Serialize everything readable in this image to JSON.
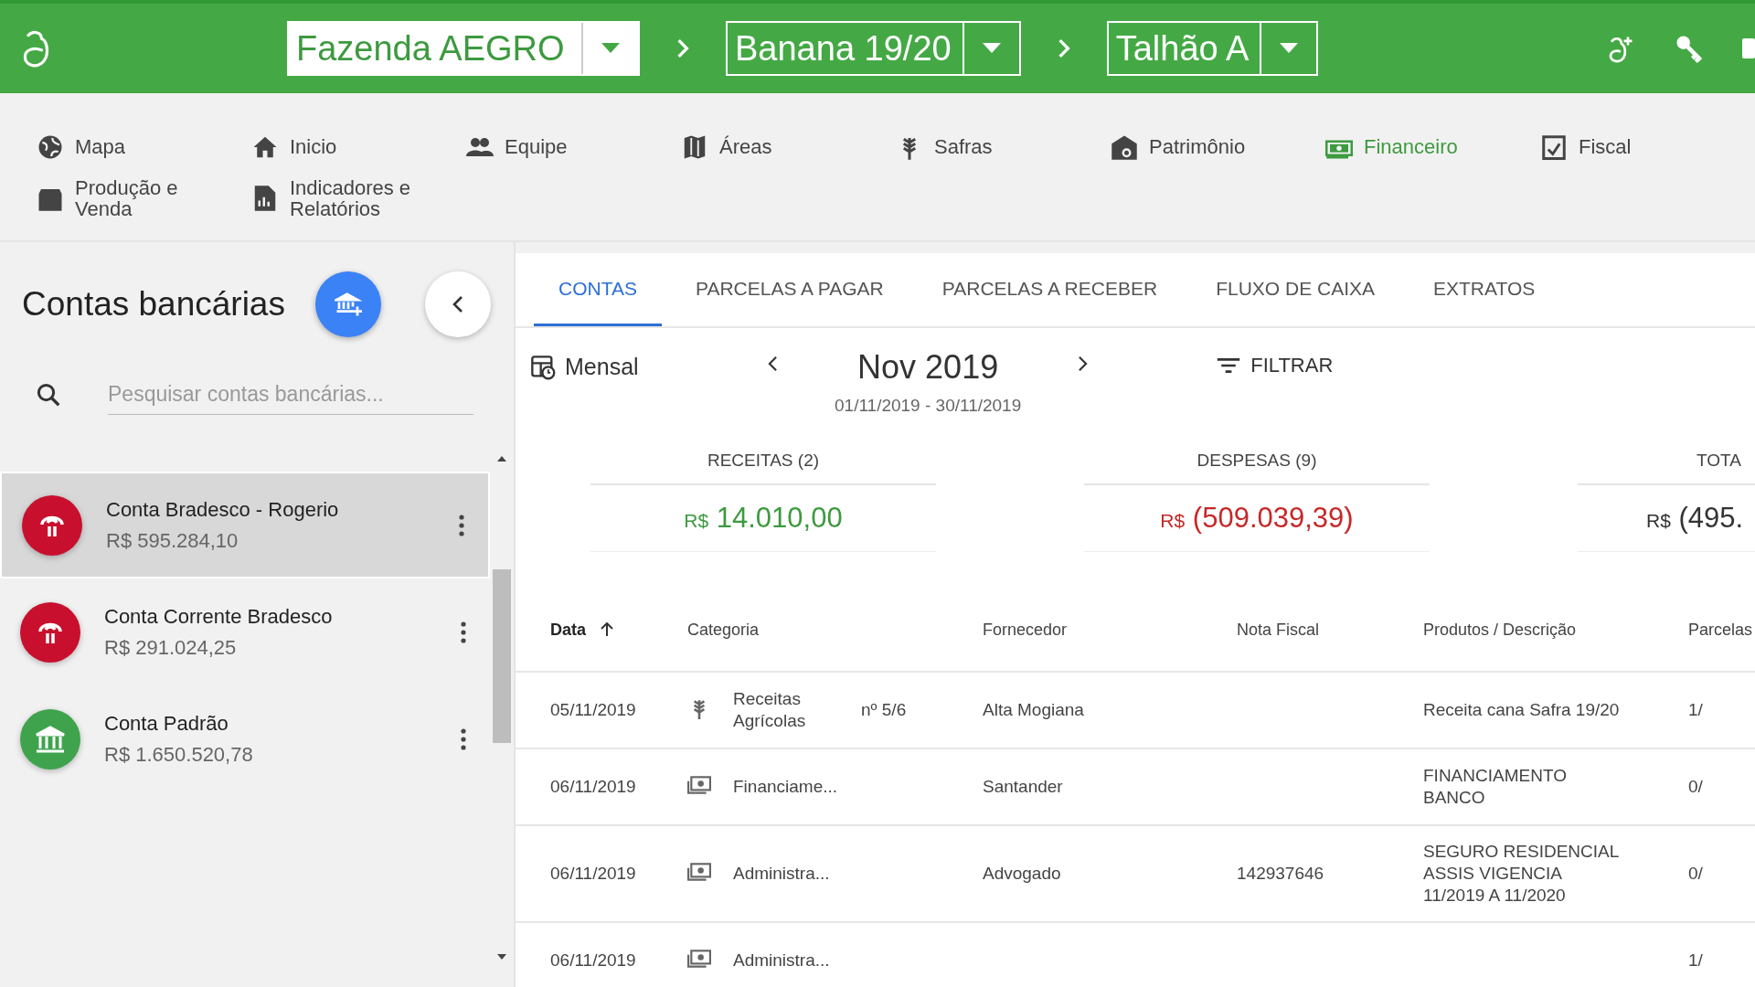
{
  "header": {
    "selectors": [
      {
        "value": "Fazenda AEGRO",
        "filled": true
      },
      {
        "value": "Banana 19/20",
        "filled": false
      },
      {
        "value": "Talhão A",
        "filled": false
      }
    ]
  },
  "nav": [
    {
      "label": "Mapa",
      "selected": false
    },
    {
      "label": "Inicio",
      "selected": false
    },
    {
      "label": "Equipe",
      "selected": false
    },
    {
      "label": "Áreas",
      "selected": false
    },
    {
      "label": "Safras",
      "selected": false
    },
    {
      "label": "Patrimônio",
      "selected": false
    },
    {
      "label": "Financeiro",
      "selected": true
    },
    {
      "label": "Fiscal",
      "selected": false
    },
    {
      "label": "Produção e Venda",
      "selected": false
    },
    {
      "label": "Indicadores e Relatórios",
      "selected": false
    }
  ],
  "sidebar": {
    "title": "Contas bancárias",
    "search": {
      "placeholder": "Pesquisar contas bancárias..."
    },
    "accounts": [
      {
        "name": "Conta Bradesco - Rogerio",
        "balance": "R$ 595.284,10",
        "kind": "bradesco",
        "color": "#c8102e",
        "selected": true
      },
      {
        "name": "Conta Corrente Bradesco",
        "balance": "R$ 291.024,25",
        "kind": "bradesco",
        "color": "#c8102e",
        "selected": false
      },
      {
        "name": "Conta Padrão",
        "balance": "R$ 1.650.520,78",
        "kind": "bank",
        "color": "#3fa34d",
        "selected": false
      }
    ]
  },
  "tabs": [
    {
      "label": "CONTAS",
      "selected": true
    },
    {
      "label": "PARCELAS A PAGAR",
      "selected": false
    },
    {
      "label": "PARCELAS A RECEBER",
      "selected": false
    },
    {
      "label": "FLUXO DE CAIXA",
      "selected": false
    },
    {
      "label": "EXTRATOS",
      "selected": false
    }
  ],
  "period": {
    "mode": "Mensal",
    "month": "Nov 2019",
    "range": "01/11/2019 - 30/11/2019",
    "filter": "FILTRAR"
  },
  "summary": [
    {
      "title": "RECEITAS (2)",
      "currency": "R$",
      "amount": "14.010,00",
      "kind": "income"
    },
    {
      "title": "DESPESAS (9)",
      "currency": "R$",
      "amount": "(509.039,39)",
      "kind": "expense"
    },
    {
      "title": "TOTA",
      "currency": "R$",
      "amount": "(495.",
      "kind": "total"
    }
  ],
  "table": {
    "columns": [
      {
        "label": "Data",
        "sorted": true
      },
      {
        "label": "Categoria",
        "sorted": false
      },
      {
        "label": "Fornecedor",
        "sorted": false
      },
      {
        "label": "Nota Fiscal",
        "sorted": false
      },
      {
        "label": "Produtos / Descrição",
        "sorted": false
      },
      {
        "label": "Parcelas",
        "sorted": false
      }
    ],
    "rows": [
      {
        "date": "05/11/2019",
        "kind": "income",
        "category": "Receitas Agrícolas",
        "installment": "nº 5/6",
        "supplier": "Alta Mogiana",
        "description": "Receita cana Safra 19/20",
        "parcel": "1/"
      },
      {
        "date": "06/11/2019",
        "kind": "expense",
        "category": "Financiame...",
        "supplier": "Santander",
        "description": "FINANCIAMENTO BANCO",
        "parcel": "0/"
      },
      {
        "date": "06/11/2019",
        "kind": "expense",
        "category": "Administra...",
        "supplier": "Advogado",
        "invoice": "142937646",
        "description": "SEGURO RESIDENCIAL ASSIS VIGENCIA 11/2019 A 11/2020",
        "parcel": "0/"
      },
      {
        "date": "06/11/2019",
        "kind": "expense",
        "category": "Administra...",
        "parcel": "1/"
      }
    ]
  }
}
